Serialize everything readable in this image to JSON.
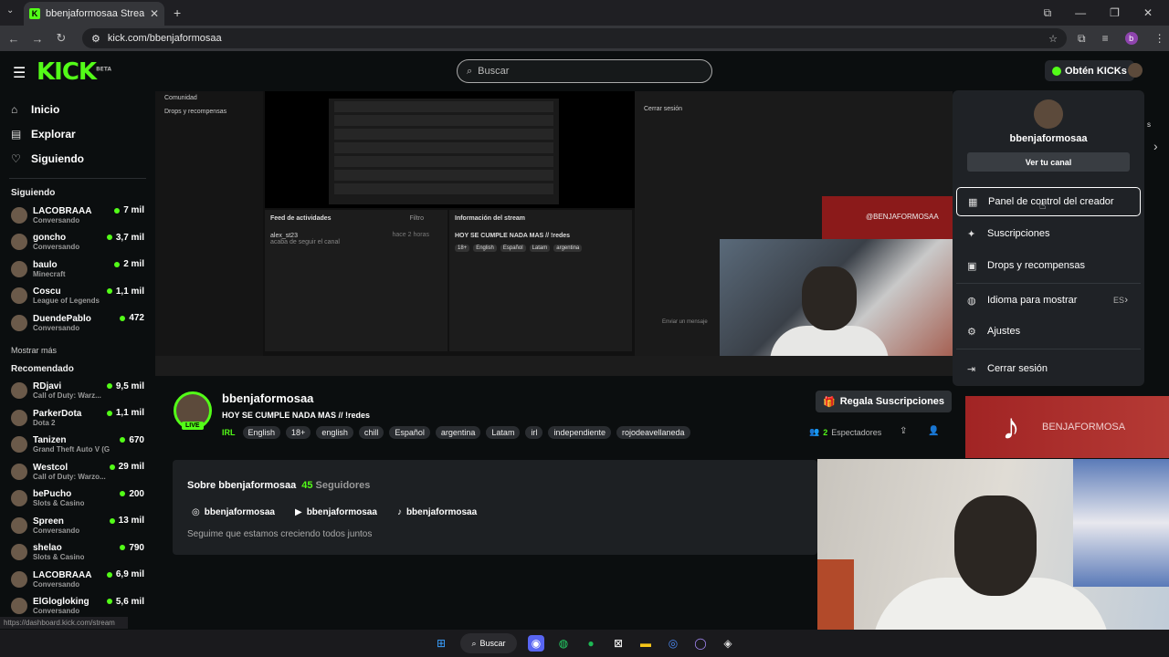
{
  "browser": {
    "tab_title": "bbenjaformosaa Stream - W",
    "url": "kick.com/bbenjaformosaa",
    "profile_initial": "b"
  },
  "header": {
    "logo": "KICK",
    "logo_beta": "BETA",
    "search_placeholder": "Buscar",
    "get_kicks": "Obtén KICKs"
  },
  "sidebar": {
    "nav": [
      {
        "label": "Inicio",
        "icon": "home-icon"
      },
      {
        "label": "Explorar",
        "icon": "explore-icon"
      },
      {
        "label": "Siguiendo",
        "icon": "heart-icon"
      }
    ],
    "following_title": "Siguiendo",
    "following": [
      {
        "name": "LACOBRAAA",
        "category": "Conversando",
        "viewers": "7 mil"
      },
      {
        "name": "goncho",
        "category": "Conversando",
        "viewers": "3,7 mil"
      },
      {
        "name": "baulo",
        "category": "Minecraft",
        "viewers": "2 mil"
      },
      {
        "name": "Coscu",
        "category": "League of Legends",
        "viewers": "1,1 mil"
      },
      {
        "name": "DuendePablo",
        "category": "Conversando",
        "viewers": "472"
      }
    ],
    "show_more": "Mostrar más",
    "recommended_title": "Recomendado",
    "recommended": [
      {
        "name": "RDjavi",
        "category": "Call of Duty: Warz...",
        "viewers": "9,5 mil"
      },
      {
        "name": "ParkerDota",
        "category": "Dota 2",
        "viewers": "1,1 mil"
      },
      {
        "name": "Tanizen",
        "category": "Grand Theft Auto V (G...",
        "viewers": "670"
      },
      {
        "name": "Westcol",
        "category": "Call of Duty: Warzo...",
        "viewers": "29 mil"
      },
      {
        "name": "bePucho",
        "category": "Slots & Casino",
        "viewers": "200"
      },
      {
        "name": "Spreen",
        "category": "Conversando",
        "viewers": "13 mil"
      },
      {
        "name": "shelao",
        "category": "Slots & Casino",
        "viewers": "790"
      },
      {
        "name": "LACOBRAAA",
        "category": "Conversando",
        "viewers": "6,9 mil"
      },
      {
        "name": "ElGlogloking",
        "category": "Conversando",
        "viewers": "5,6 mil"
      }
    ],
    "status_url": "https://dashboard.kick.com/stream"
  },
  "player": {
    "left_menu": [
      "Comunidad",
      "Drops y recompensas"
    ],
    "logout_item": "Cerrar sesión",
    "feed_title": "Feed de actividades",
    "feed_filter": "Filtro",
    "feed_user": "alex_st23",
    "feed_text": "acaba de seguir el canal",
    "feed_time": "hace 2 horas",
    "info_title": "Información del stream",
    "info_stream_title": "HOY SE CUMPLE NADA MAS // !redes",
    "mini_tags": [
      "18+",
      "English",
      "Español",
      "Latam",
      "argentina"
    ],
    "banner_text": "@BENJAFORMOSAA",
    "chat_placeholder": "Enviar un mensaje"
  },
  "stream": {
    "channel": "bbenjaformosaa",
    "live": "LIVE",
    "title": "HOY SE CUMPLE NADA MAS // !redes",
    "category": "IRL",
    "tags": [
      "English",
      "18+",
      "english",
      "chill",
      "Español",
      "argentina",
      "Latam",
      "irl",
      "independiente",
      "rojodeavellaneda"
    ],
    "gift_subs": "Regala Suscripciones",
    "viewers_count": "2",
    "viewers_label": "Espectadores"
  },
  "about": {
    "title": "Sobre bbenjaformosaa",
    "followers_count": "45",
    "followers_label": "Seguidores",
    "socials": [
      {
        "icon": "instagram-icon",
        "handle": "bbenjaformosaa"
      },
      {
        "icon": "youtube-icon",
        "handle": "bbenjaformosaa"
      },
      {
        "icon": "tiktok-icon",
        "handle": "bbenjaformosaa"
      }
    ],
    "description": "Seguime que estamos creciendo todos juntos"
  },
  "tiktok_overlay": {
    "name": "BENJAFORMOSA"
  },
  "dropdown": {
    "username": "bbenjaformosaa",
    "view_channel": "Ver tu canal",
    "items": [
      {
        "label": "Panel de control del creador",
        "icon": "dashboard-icon"
      },
      {
        "label": "Suscripciones",
        "icon": "star-icon"
      },
      {
        "label": "Drops y recompensas",
        "icon": "gift-icon"
      },
      {
        "label": "Idioma para mostrar",
        "icon": "globe-icon",
        "value": "ES"
      },
      {
        "label": "Ajustes",
        "icon": "gear-icon"
      },
      {
        "label": "Cerrar sesión",
        "icon": "logout-icon"
      }
    ]
  },
  "taskbar": {
    "search": "Buscar"
  },
  "colors": {
    "accent": "#53fc18",
    "background": "#0b0e0f",
    "panel": "#1f2226"
  }
}
